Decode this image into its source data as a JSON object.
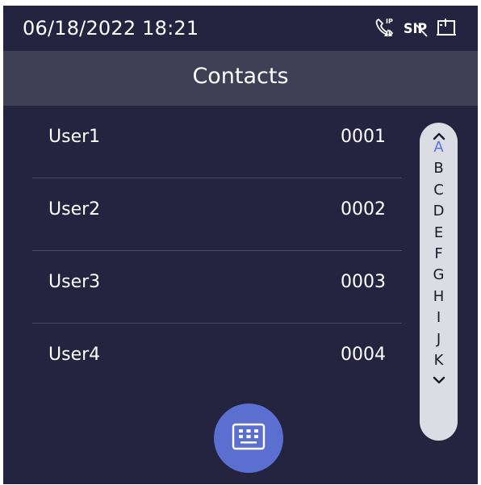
{
  "status": {
    "datetime": "06/18/2022 18:21",
    "icons": [
      "ip-call-alert-icon",
      "sip-icon",
      "door-icon"
    ],
    "ip_label": "IP",
    "sip_label": "SIP"
  },
  "header": {
    "title": "Contacts"
  },
  "contacts": [
    {
      "name": "User1",
      "number": "0001"
    },
    {
      "name": "User2",
      "number": "0002"
    },
    {
      "name": "User3",
      "number": "0003"
    },
    {
      "name": "User4",
      "number": "0004"
    }
  ],
  "alpha_index": {
    "letters": [
      "A",
      "B",
      "C",
      "D",
      "E",
      "F",
      "G",
      "H",
      "I",
      "J",
      "K"
    ],
    "active": "A",
    "up_icon": "chevron-up-icon",
    "down_icon": "chevron-down-icon"
  },
  "keypad": {
    "icon": "keyboard-icon"
  },
  "colors": {
    "background": "#242441",
    "titlebar": "#3f3f56",
    "accent": "#5b6fd0",
    "active_letter": "#5a70e6",
    "index_bg": "#dcdce4"
  }
}
